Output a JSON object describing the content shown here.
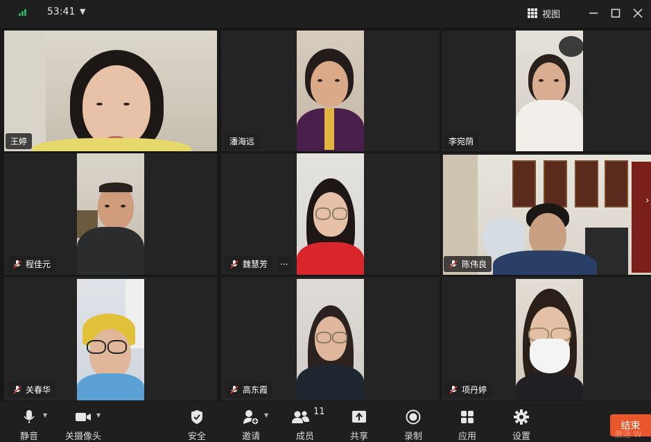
{
  "topbar": {
    "timer": "53:41",
    "view_label": "视图",
    "signal_color": "#27ae60"
  },
  "participants": [
    {
      "name": "王婷",
      "muted": false
    },
    {
      "name": "潘海远",
      "muted": false
    },
    {
      "name": "李宛荫",
      "muted": false
    },
    {
      "name": "程佳元",
      "muted": true
    },
    {
      "name": "魏慧芳",
      "muted": true,
      "more": "···"
    },
    {
      "name": "陈伟良",
      "muted": true
    },
    {
      "name": "关春华",
      "muted": true
    },
    {
      "name": "高东霞",
      "muted": true
    },
    {
      "name": "项丹婷",
      "muted": true
    }
  ],
  "toolbar": {
    "mute_label": "静音",
    "camera_label": "关摄像头",
    "security_label": "安全",
    "invite_label": "邀请",
    "members_label": "成员",
    "members_count": "11",
    "share_label": "共享",
    "record_label": "录制",
    "apps_label": "应用",
    "settings_label": "设置",
    "end_label": "结束"
  },
  "watermark": "激活 W",
  "colors": {
    "end_button": "#e8572b",
    "background": "#1a1a1a",
    "tile": "#242424"
  },
  "icons": {
    "signal": "signal-icon",
    "view": "grid-view-icon",
    "mic": "mic-icon",
    "camera": "camera-icon",
    "security": "shield-icon",
    "invite": "add-user-icon",
    "members": "people-icon",
    "share": "share-icon",
    "record": "record-icon",
    "apps": "apps-icon",
    "settings": "gear-icon",
    "muted": "mic-muted-icon"
  }
}
